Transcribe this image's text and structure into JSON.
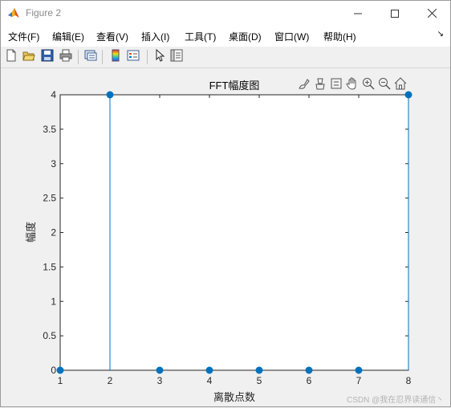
{
  "window": {
    "title": "Figure 2",
    "minimize_icon": "minimize-icon",
    "maximize_icon": "maximize-icon",
    "close_icon": "close-icon"
  },
  "menu": {
    "items": [
      "文件(F)",
      "编辑(E)",
      "查看(V)",
      "插入(I)",
      "工具(T)",
      "桌面(D)",
      "窗口(W)",
      "帮助(H)"
    ],
    "overflow": "↘"
  },
  "toolbar": {
    "icons": [
      "new-figure-icon",
      "open-file-icon",
      "save-icon",
      "print-icon",
      "link-plot-icon",
      "colorbar-icon",
      "legend-icon",
      "edit-plot-cursor-icon",
      "property-inspector-icon"
    ]
  },
  "axes_toolbar": {
    "icons": [
      "brush-icon",
      "data-tips-icon",
      "link-data-icon",
      "pan-hand-icon",
      "zoom-in-icon",
      "zoom-out-icon",
      "home-restore-icon"
    ]
  },
  "chart_data": {
    "type": "stem",
    "title": "FFT幅度图",
    "xlabel": "离散点数",
    "ylabel": "幅度",
    "x": [
      1,
      2,
      3,
      4,
      5,
      6,
      7,
      8
    ],
    "y": [
      0,
      4,
      0,
      0,
      0,
      0,
      0,
      4
    ],
    "xlim": [
      1,
      8
    ],
    "ylim": [
      0,
      4
    ],
    "xticks": [
      "1",
      "2",
      "3",
      "4",
      "5",
      "6",
      "7",
      "8"
    ],
    "yticks": [
      "0",
      "0.5",
      "1",
      "1.5",
      "2",
      "2.5",
      "3",
      "3.5",
      "4"
    ],
    "series_color": "#0072BD",
    "grid": false
  },
  "watermark": "CSDN @我在忍界读通信丶"
}
